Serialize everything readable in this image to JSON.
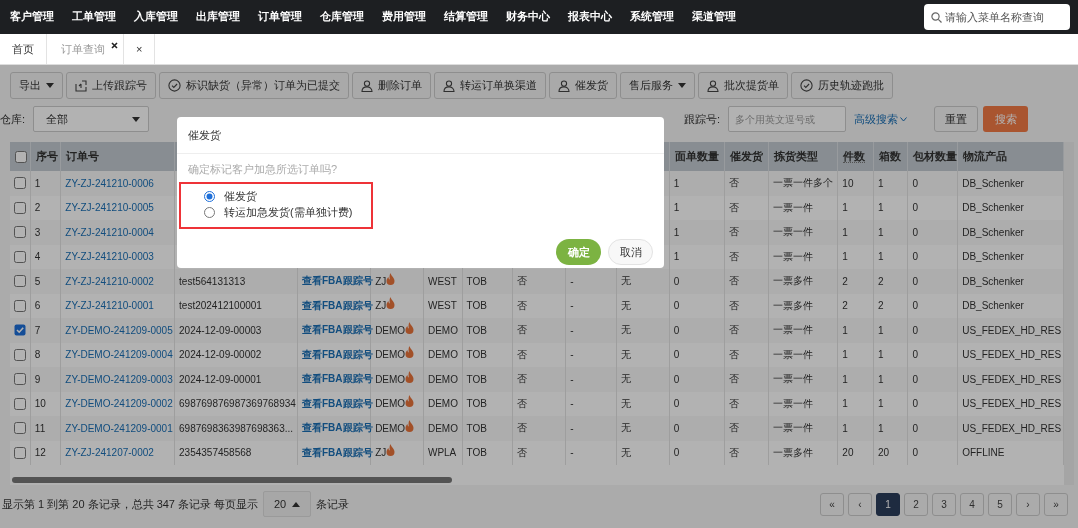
{
  "top_nav": {
    "items": [
      "客户管理",
      "工单管理",
      "入库管理",
      "出库管理",
      "订单管理",
      "仓库管理",
      "费用管理",
      "结算管理",
      "财务中心",
      "报表中心",
      "系统管理",
      "渠道管理"
    ],
    "search": {
      "placeholder": "请输入菜单名称查询"
    }
  },
  "tabs": [
    {
      "label": "首页",
      "selected": false,
      "closable": false
    },
    {
      "label": "订单查询",
      "selected": true,
      "closable": true
    },
    {
      "label": "×",
      "selected": false,
      "closable": false
    }
  ],
  "toolbar": [
    {
      "label": "导出",
      "kind": "plain",
      "dropdown": true
    },
    {
      "label": "上传跟踪号",
      "kind": "upload",
      "dropdown": false
    },
    {
      "label": "标识缺货（异常）订单为已提交",
      "kind": "check",
      "dropdown": false
    },
    {
      "label": "删除订单",
      "kind": "user",
      "dropdown": false
    },
    {
      "label": "转运订单换渠道",
      "kind": "user",
      "dropdown": false
    },
    {
      "label": "催发货",
      "kind": "user",
      "dropdown": false
    },
    {
      "label": "售后服务",
      "kind": "plain",
      "dropdown": true
    },
    {
      "label": "批次提货单",
      "kind": "user",
      "dropdown": false
    },
    {
      "label": "历史轨迹跑批",
      "kind": "check",
      "dropdown": false
    }
  ],
  "filters": {
    "warehouse_label": "仓库:",
    "warehouse_value": "全部",
    "tracking_label": "跟踪号:",
    "tracking_placeholder": "多个用英文逗号或",
    "advanced_search": "高级搜索",
    "reset": "重置",
    "search": "搜索"
  },
  "table": {
    "select_all_checked": false,
    "columns": [
      {
        "label": "序号",
        "kind": "text"
      },
      {
        "label": "订单号",
        "kind": "link"
      },
      {
        "kind": "text"
      },
      {
        "kind": "link"
      },
      {
        "kind": "flame"
      },
      {
        "kind": "text"
      },
      {
        "kind": "text"
      },
      {
        "kind": "text"
      },
      {
        "kind": "text"
      },
      {
        "kind": "text"
      },
      {
        "label": "面单数量",
        "kind": "text"
      },
      {
        "label": "催发货",
        "kind": "text"
      },
      {
        "label": "拣货类型",
        "kind": "text"
      },
      {
        "label": "件数",
        "kind": "text"
      },
      {
        "label": "箱数",
        "kind": "text"
      },
      {
        "label": "包材数量",
        "kind": "text"
      },
      {
        "label": "物流产品",
        "kind": "text"
      }
    ],
    "rows": [
      {
        "checked": false,
        "cells": [
          "1",
          "ZY-ZJ-241210-0006",
          null,
          null,
          null,
          null,
          null,
          null,
          null,
          null,
          "1",
          "否",
          "一票一件多个",
          "10",
          "1",
          "0",
          "DB_Schenker"
        ]
      },
      {
        "checked": false,
        "cells": [
          "2",
          "ZY-ZJ-241210-0005",
          null,
          null,
          null,
          null,
          null,
          null,
          null,
          null,
          "1",
          "否",
          "一票一件",
          "1",
          "1",
          "0",
          "DB_Schenker"
        ]
      },
      {
        "checked": false,
        "cells": [
          "3",
          "ZY-ZJ-241210-0004",
          null,
          null,
          null,
          null,
          null,
          null,
          null,
          null,
          "1",
          "否",
          "一票一件",
          "1",
          "1",
          "0",
          "DB_Schenker"
        ]
      },
      {
        "checked": false,
        "cells": [
          "4",
          "ZY-ZJ-241210-0003",
          null,
          null,
          null,
          null,
          null,
          null,
          null,
          null,
          "1",
          "否",
          "一票一件",
          "1",
          "1",
          "0",
          "DB_Schenker"
        ]
      },
      {
        "checked": false,
        "cells": [
          "5",
          "ZY-ZJ-241210-0002",
          "test564131313",
          "查看FBA跟踪号",
          "ZJ",
          "WEST",
          "TOB",
          "否",
          "-",
          "无",
          "0",
          "否",
          "一票多件",
          "2",
          "2",
          "0",
          "DB_Schenker"
        ]
      },
      {
        "checked": false,
        "cells": [
          "6",
          "ZY-ZJ-241210-0001",
          "test202412100001",
          "查看FBA跟踪号",
          "ZJ",
          "WEST",
          "TOB",
          "否",
          "-",
          "无",
          "0",
          "否",
          "一票多件",
          "2",
          "2",
          "0",
          "DB_Schenker"
        ]
      },
      {
        "checked": true,
        "cells": [
          "7",
          "ZY-DEMO-241209-0005",
          "2024-12-09-00003",
          "查看FBA跟踪号",
          "DEMO",
          "DEMO",
          "TOB",
          "否",
          "-",
          "无",
          "0",
          "否",
          "一票一件",
          "1",
          "1",
          "0",
          "US_FEDEX_HD_RES"
        ]
      },
      {
        "checked": false,
        "cells": [
          "8",
          "ZY-DEMO-241209-0004",
          "2024-12-09-00002",
          "查看FBA跟踪号",
          "DEMO",
          "DEMO",
          "TOB",
          "否",
          "-",
          "无",
          "0",
          "否",
          "一票一件",
          "1",
          "1",
          "0",
          "US_FEDEX_HD_RES"
        ]
      },
      {
        "checked": false,
        "cells": [
          "9",
          "ZY-DEMO-241209-0003",
          "2024-12-09-00001",
          "查看FBA跟踪号",
          "DEMO",
          "DEMO",
          "TOB",
          "否",
          "-",
          "无",
          "0",
          "否",
          "一票一件",
          "1",
          "1",
          "0",
          "US_FEDEX_HD_RES"
        ]
      },
      {
        "checked": false,
        "cells": [
          "10",
          "ZY-DEMO-241209-0002",
          "698769876987369768934",
          "查看FBA跟踪号",
          "DEMO",
          "DEMO",
          "TOB",
          "否",
          "-",
          "无",
          "0",
          "否",
          "一票一件",
          "1",
          "1",
          "0",
          "US_FEDEX_HD_RES"
        ]
      },
      {
        "checked": false,
        "cells": [
          "11",
          "ZY-DEMO-241209-0001",
          "6987698363987698363...",
          "查看FBA跟踪号",
          "DEMO",
          "DEMO",
          "TOB",
          "否",
          "-",
          "无",
          "0",
          "否",
          "一票一件",
          "1",
          "1",
          "0",
          "US_FEDEX_HD_RES"
        ]
      },
      {
        "checked": false,
        "cells": [
          "12",
          "ZY-ZJ-241207-0002",
          "2354357458568",
          "查看FBA跟踪号",
          "ZJ",
          "WPLA",
          "TOB",
          "否",
          "-",
          "无",
          "0",
          "否",
          "一票多件",
          "20",
          "20",
          "0",
          "OFFLINE"
        ]
      }
    ]
  },
  "footer": {
    "summary": "显示第 1 到第 20 条记录，总共 347 条记录 每页显示",
    "page_size": "20",
    "suffix": "条记录",
    "pages": [
      {
        "label": "«",
        "selected": false
      },
      {
        "label": "‹",
        "selected": false
      },
      {
        "label": "1",
        "selected": true
      },
      {
        "label": "2",
        "selected": false
      },
      {
        "label": "3",
        "selected": false
      },
      {
        "label": "4",
        "selected": false
      },
      {
        "label": "5",
        "selected": false
      },
      {
        "label": "›",
        "selected": false
      },
      {
        "label": "»",
        "selected": false
      }
    ]
  },
  "dialog": {
    "title": "催发货",
    "message": "确定标记客户加急所选订单吗?",
    "options": [
      {
        "label": "催发货",
        "selected": true
      },
      {
        "label": "转运加急发货(需单独计费)",
        "selected": false
      }
    ],
    "highlighted": true,
    "confirm": "确定",
    "cancel": "取消"
  }
}
